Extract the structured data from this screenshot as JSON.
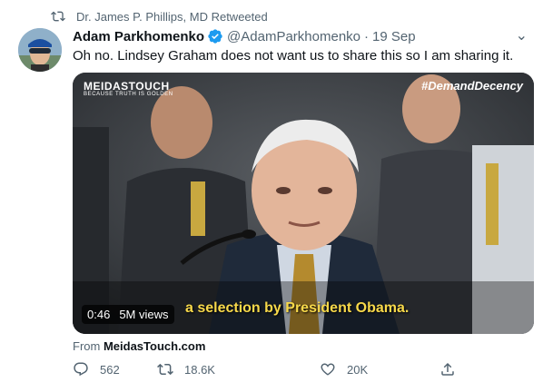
{
  "retweet": {
    "label": "Dr. James P. Phillips, MD Retweeted",
    "icon": "retweet-icon"
  },
  "author": {
    "name": "Adam Parkhomenko",
    "handle": "@AdamParkhomenko",
    "separator": "·",
    "date": "19 Sep",
    "verified": true
  },
  "more_label": "⌄",
  "tweet": {
    "text": "Oh no. Lindsey Graham does not want us to share this so I am sharing it."
  },
  "media": {
    "brand_title": "MEIDASTOUCH",
    "brand_tagline": "BECAUSE TRUTH IS GOLDEN",
    "hashtag": "#DemandDecency",
    "caption": "a selection by President Obama.",
    "duration": "0:46",
    "views": "5M views"
  },
  "source": {
    "prefix": "From",
    "name": "MeidasTouch.com"
  },
  "actions": {
    "reply_count": "562",
    "retweet_count": "18.6K",
    "like_count": "20K"
  },
  "colors": {
    "accent": "#1d9bf0",
    "muted": "#536471",
    "caption_yellow": "#f8d94a"
  }
}
